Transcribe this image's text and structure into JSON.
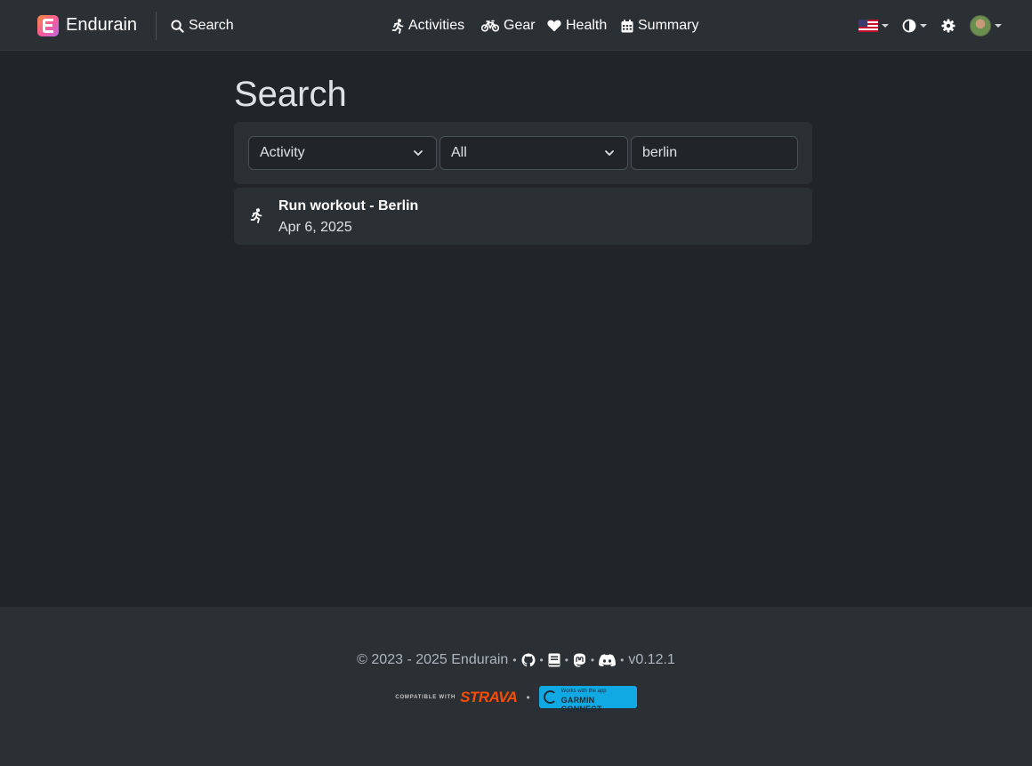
{
  "navbar": {
    "brand": "Endurain",
    "search_label": "Search",
    "links": [
      {
        "label": "Activities",
        "icon": "running-icon"
      },
      {
        "label": "Gear",
        "icon": "bicycle-icon"
      },
      {
        "label": "Health",
        "icon": "heart-icon"
      },
      {
        "label": "Summary",
        "icon": "calendar-icon"
      }
    ],
    "right": {
      "language_icon": "us-flag-icon",
      "theme_icon": "theme-toggle-icon",
      "settings_icon": "gear-icon",
      "user_icon": "avatar"
    }
  },
  "main": {
    "title": "Search",
    "filters": {
      "type_value": "Activity",
      "subtype_value": "All",
      "query_value": "berlin"
    },
    "results": [
      {
        "title": "Run workout - Berlin",
        "date": "Apr 6, 2025",
        "icon": "running-icon"
      }
    ]
  },
  "footer": {
    "copyright": "© 2023 - 2025 Endurain",
    "version": "v0.12.1",
    "icons": [
      "github-icon",
      "docs-icon",
      "mastodon-icon",
      "discord-icon"
    ],
    "strava_compat": "COMPATIBLE WITH",
    "strava_logo": "STRAVA",
    "garmin_small": "Works with the app",
    "garmin_big": "GARMIN CONNECT"
  },
  "colors": {
    "background": "#212529",
    "surface": "#2b3035",
    "strava": "#fc4c02",
    "garmin": "#11a9e3"
  }
}
